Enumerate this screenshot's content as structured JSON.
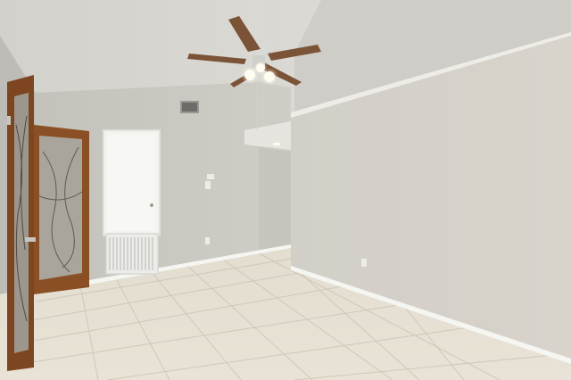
{
  "scene": {
    "description_visible_text": "",
    "colors": {
      "wall_left": "#c9c7c0",
      "wall_right": "#d3cec6",
      "ceiling": "#dcdad5",
      "floor_tile": "#e6e0d3",
      "grout": "#cfc7b8",
      "baseboard": "#f7f7f5",
      "door_wood": "#8a4f25",
      "glass_panel": "#a9a59c",
      "closet_door": "#f3f3f0",
      "vent": "#ecece9",
      "fan_blade": "#7b5336",
      "fan_metal": "#d9d9d6",
      "light_glow": "#fffdf2"
    },
    "icons": [
      "ceiling-fan-icon",
      "door-icon",
      "vent-icon"
    ]
  }
}
